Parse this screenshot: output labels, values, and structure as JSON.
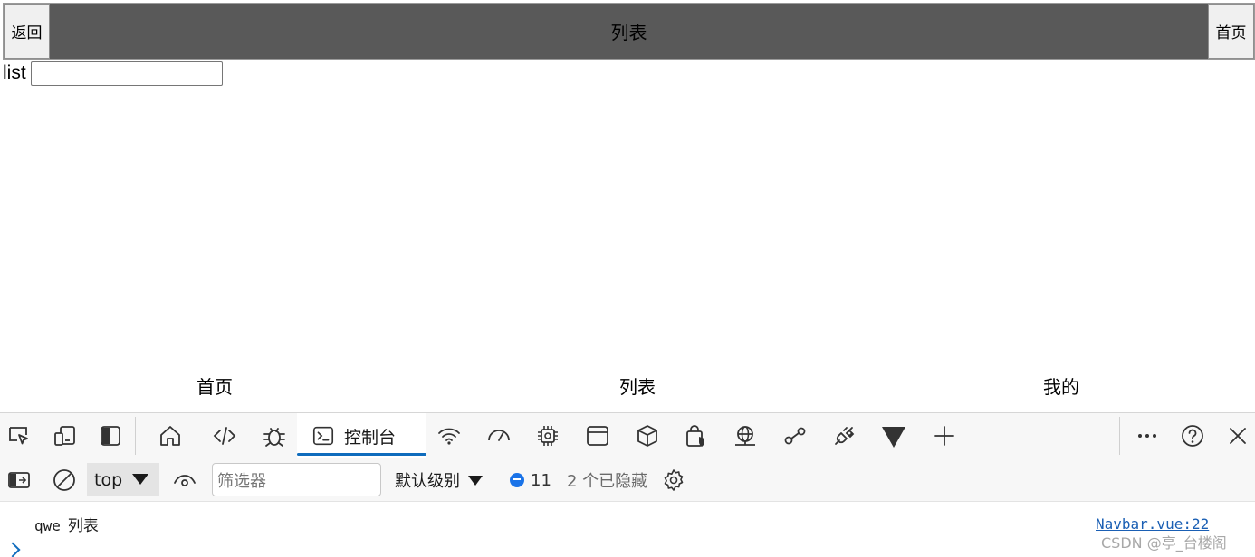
{
  "app": {
    "navbar": {
      "back_label": "返回",
      "title": "列表",
      "home_label": "首页"
    },
    "list_field": {
      "label": "list",
      "value": ""
    },
    "tabbar": {
      "items": [
        {
          "label": "首页"
        },
        {
          "label": "列表"
        },
        {
          "label": "我的"
        }
      ]
    }
  },
  "devtools": {
    "toolbar": {
      "icons": [
        "inspect-icon",
        "device-emulation-icon",
        "dock-side-icon",
        "welcome-home-icon",
        "elements-icon",
        "sources-debug-icon",
        "network-wifi-icon",
        "performance-gauge-icon",
        "memory-chip-icon",
        "application-window-icon",
        "3d-view-icon",
        "security-bag-icon",
        "network-globe-icon",
        "performance-link-icon",
        "network-plug-icon",
        "vue-devtools-icon",
        "add-tool-icon",
        "more-tools-icon",
        "help-icon",
        "close-icon"
      ],
      "active_tab": "控制台",
      "accent": "#0f6cbd"
    },
    "filterbar": {
      "context": "top",
      "filter_placeholder": "筛选器",
      "level": "默认级别",
      "message_count": "11",
      "hidden_count": "2 个已隐藏"
    },
    "console": {
      "entries": [
        {
          "text_mono": "qwe",
          "text": "列表",
          "source": "Navbar.vue:22"
        }
      ]
    }
  },
  "watermark": "CSDN @亭_台楼阁"
}
